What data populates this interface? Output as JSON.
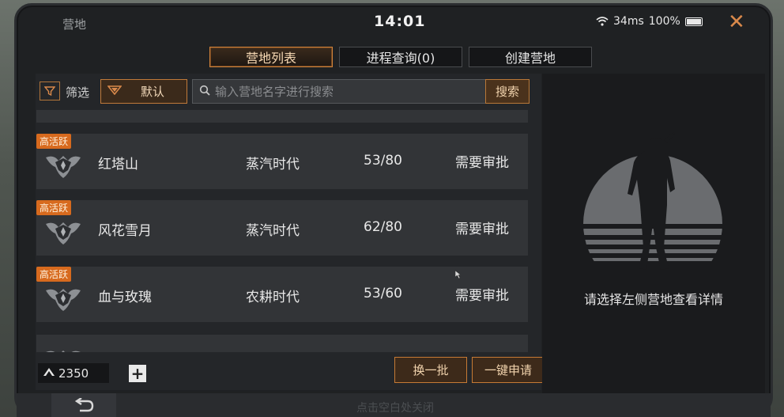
{
  "status": {
    "camp_label": "营地",
    "time": "14:01",
    "ping": "34ms",
    "battery": "100%",
    "close_icon": "close-icon"
  },
  "tabs": [
    {
      "label": "营地列表",
      "active": true
    },
    {
      "label": "进程查询(0)",
      "active": false
    },
    {
      "label": "创建营地",
      "active": false
    }
  ],
  "filter": {
    "label": "筛选",
    "sort_value": "默认",
    "search_placeholder": "输入营地名字进行搜索",
    "search_button": "搜索"
  },
  "camps": [
    {
      "badge": "高活跃",
      "name": "红塔山",
      "era": "蒸汽时代",
      "members": "53/80",
      "approval": "需要审批"
    },
    {
      "badge": "高活跃",
      "name": "风花雪月",
      "era": "蒸汽时代",
      "members": "62/80",
      "approval": "需要审批"
    },
    {
      "badge": "高活跃",
      "name": "血与玫瑰",
      "era": "农耕时代",
      "members": "53/60",
      "approval": "需要审批"
    }
  ],
  "footer_bar": {
    "currency_value": "2350",
    "refresh_button": "换一批",
    "apply_all_button": "一键申请"
  },
  "detail_panel": {
    "hint": "请选择左侧营地查看详情"
  },
  "bottom": {
    "close_hint": "点击空白处关闭"
  },
  "colors": {
    "accent": "#d9894b",
    "badge": "#d76a1e",
    "panel": "#242629",
    "row": "#323437"
  }
}
